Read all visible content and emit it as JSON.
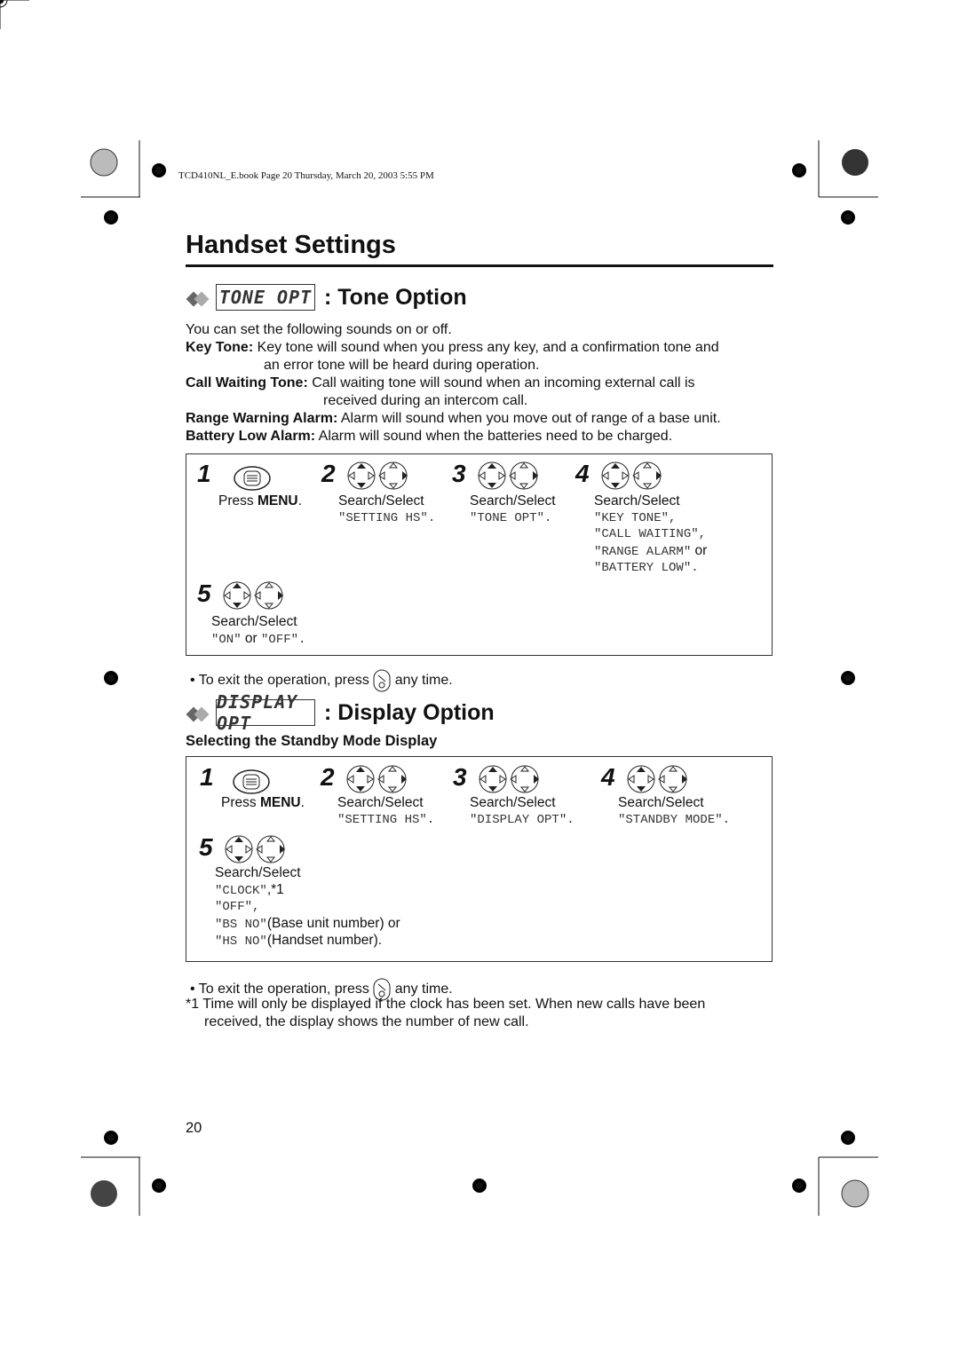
{
  "header": {
    "file_line": "TCD410NL_E.book  Page 20  Thursday, March 20, 2003  5:55 PM"
  },
  "title": "Handset Settings",
  "tone": {
    "lcd": "TONE OPT",
    "heading": ": Tone Option",
    "intro": "You can set the following sounds on or off.",
    "items": [
      {
        "term": "Key Tone:",
        "text": " Key tone will sound when you press any key, and a confirmation tone and",
        "cont": "an error tone will be heard during operation."
      },
      {
        "term": "Call Waiting Tone:",
        "text": " Call waiting tone will sound when an incoming external call is",
        "cont": "received during an intercom call."
      },
      {
        "term": "Range Warning Alarm:",
        "text": " Alarm will sound when you move out of range of a base unit."
      },
      {
        "term": "Battery Low Alarm:",
        "text": " Alarm will sound when the batteries need to be charged."
      }
    ],
    "steps": [
      {
        "n": "1",
        "l1a": "Press ",
        "l1b": "MENU",
        "l1c": "."
      },
      {
        "n": "2",
        "l1": "Search/Select",
        "m": "\"SETTING HS\"."
      },
      {
        "n": "3",
        "l1": "Search/Select",
        "m": "\"TONE OPT\"."
      },
      {
        "n": "4",
        "l1": "Search/Select",
        "m1": "\"KEY TONE\",",
        "m2": "\"CALL WAITING\",",
        "m3": "\"RANGE ALARM\"",
        "or": " or",
        "m4": "\"BATTERY LOW\"."
      },
      {
        "n": "5",
        "l1": "Search/Select",
        "m1": "\"ON\"",
        "or": " or ",
        "m2": "\"OFF\"."
      }
    ],
    "exit_a": "To exit the operation, press",
    "exit_b": "any time."
  },
  "display": {
    "lcd": "DISPLAY OPT",
    "heading": ": Display Option",
    "subheading": "Selecting the Standby Mode Display",
    "steps": [
      {
        "n": "1",
        "l1a": "Press ",
        "l1b": "MENU",
        "l1c": "."
      },
      {
        "n": "2",
        "l1": "Search/Select",
        "m": "\"SETTING HS\"."
      },
      {
        "n": "3",
        "l1": "Search/Select",
        "m": "\"DISPLAY OPT\"."
      },
      {
        "n": "4",
        "l1": "Search/Select",
        "m": "\"STANDBY MODE\"."
      },
      {
        "n": "5",
        "l1": "Search/Select",
        "m1": "\"CLOCK\"",
        "t1": ",*1",
        "m2": "\"OFF\",",
        "m3": "\"BS NO\"",
        "t3": "(Base unit number) or",
        "m4": "\"HS NO\"",
        "t4": "(Handset number)."
      }
    ],
    "exit_a": "To exit the operation, press",
    "exit_b": "any time.",
    "note_mark": "*1",
    "note1": "Time will only be displayed if the clock has been set. When new calls have been",
    "note2": "received, the display shows the number of new call."
  },
  "page_number": "20"
}
